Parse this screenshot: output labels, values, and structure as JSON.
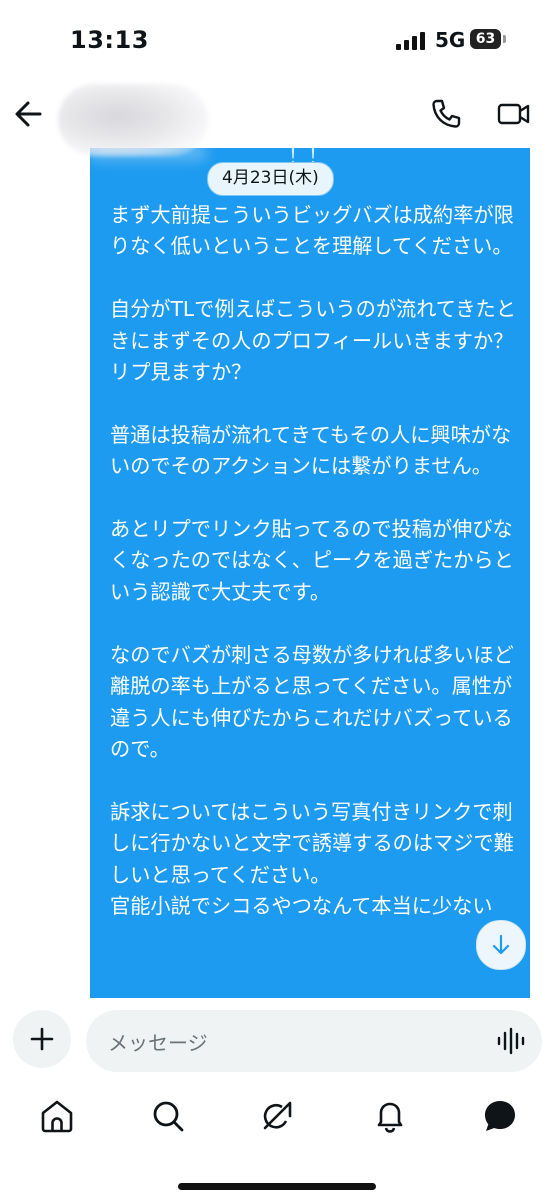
{
  "status_bar": {
    "time": "13:13",
    "network": "5G",
    "battery": "63"
  },
  "header": {
    "back_icon": "arrow-left-icon",
    "call_icon": "phone-icon",
    "video_icon": "video-camera-icon"
  },
  "conversation": {
    "date_separator": "4月23日(木)",
    "top_fragment": "！！",
    "message": "まず大前提こういうビッグバズは成約率が限りなく低いということを理解してください。\n\n自分がTLで例えばこういうのが流れてきたときにまずその人のプロフィールいきますか？リプ見ますか？\n\n普通は投稿が流れてきてもその人に興味がないのでそのアクションには繋がりません。\n\nあとリプでリンク貼ってるので投稿が伸びなくなったのではなく、ピークを過ぎたからという認識で大丈夫です。\n\nなのでバズが刺さる母数が多ければ多いほど離脱の率も上がると思ってください。属性が違う人にも伸びたからこれだけバズっているので。\n\n訴求についてはこういう写真付きリンクで刺しに行かないと文字で誘導するのはマジで難しいと思ってください。\n官能小説でシコるやつなんて本当に少ない"
  },
  "composer": {
    "placeholder": "メッセージ"
  },
  "bottom_nav": {
    "items": [
      "home-icon",
      "search-icon",
      "grok-icon",
      "notifications-icon",
      "messages-icon"
    ]
  },
  "colors": {
    "bubble": "#1d9bf0",
    "date_pill_bg": "#e8f5fd",
    "input_bg": "#eff3f4"
  }
}
